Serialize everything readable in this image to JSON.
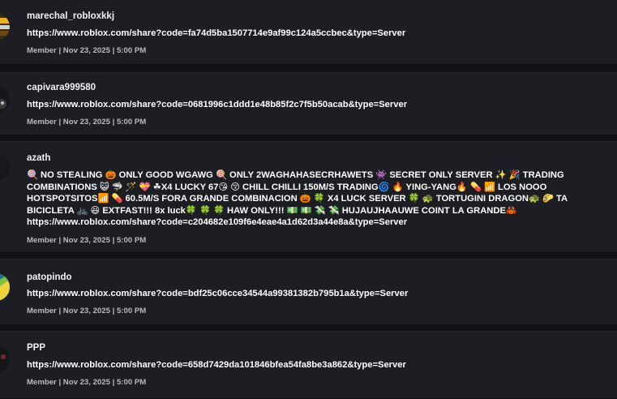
{
  "posts": [
    {
      "author": "marechal_robloxkkj",
      "lines": [
        "https://www.roblox.com/share?code=fa74d5ba1507714e9af99c124a5ccbec&type=Server"
      ],
      "meta": "Member | Nov 23, 2025 | 5:00 PM"
    },
    {
      "author": "capivara999580",
      "lines": [
        "https://www.roblox.com/share?code=0681996c1ddd1e48b85f2c7f5b50acab&type=Server"
      ],
      "meta": "Member | Nov 23, 2025 | 5:00 PM"
    },
    {
      "author": "azath",
      "lines": [
        "🍭 NO STEALING 🎃 ONLY GOOD WGAWG 🍭 ONLY 2WAGHAHASECRHAWETS 👾 SECRET ONLY SERVER ✨ 🎉 TRADING",
        "COMBINATIONS 😺 🦈 🪄 💝 ☘X4 LUCKY 67😘 😚 CHILL CHILLI 150M/S TRADING🌀 🔥 YING-YANG🔥 💊 📶 LOS NOOO",
        "HOTSPOTSITOS📶 💊 60.5M/S FORA GRANDE COMBINACION 🎃 🍀 X4 LUCK SERVER 🍀 🐢 TORTUGINI DRAGON🐢 🌮 TA",
        "BICICLETA 🚲 😆 EXTFAST!!! 8x luck🍀 🍀 🍀 HAW ONLY!!! 💵 💵 💸 💸 HUJAUJHAAUWE COINT LA GRANDE🦀",
        "https://www.roblox.com/share?code=c204682e109f6e4eae4a1d62d3a44e8a&type=Server"
      ],
      "meta": "Member | Nov 23, 2025 | 5:00 PM"
    },
    {
      "author": "patopindo",
      "lines": [
        "https://www.roblox.com/share?code=bdf25c06cce34544a99381382b795b1a&type=Server"
      ],
      "meta": "Member | Nov 23, 2025 | 5:00 PM"
    },
    {
      "author": "PPP",
      "lines": [
        "https://www.roblox.com/share?code=658d7429da101846bfea54fa8be3a862&type=Server"
      ],
      "meta": "Member | Nov 23, 2025 | 5:00 PM"
    }
  ]
}
